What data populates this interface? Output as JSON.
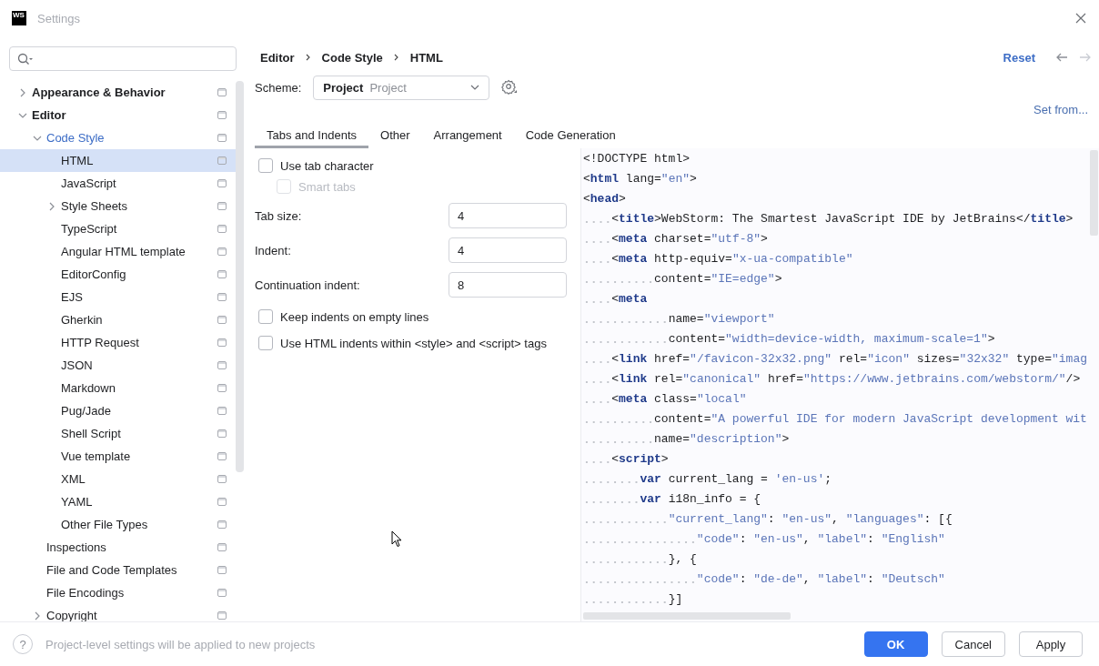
{
  "window": {
    "logo": "WS",
    "title": "Settings"
  },
  "sidebar": {
    "tree": [
      {
        "label": "Appearance & Behavior",
        "kind": "group",
        "expanded": false,
        "selected": false,
        "modified": false
      },
      {
        "label": "Editor",
        "kind": "group",
        "expanded": true,
        "selected": false,
        "modified": false,
        "children": [
          {
            "label": "Code Style",
            "kind": "group",
            "expanded": true,
            "selected": false,
            "modified": true,
            "children": [
              {
                "label": "HTML",
                "kind": "page",
                "selected": true,
                "modified": false
              },
              {
                "label": "JavaScript",
                "kind": "page",
                "selected": false,
                "modified": false
              },
              {
                "label": "Style Sheets",
                "kind": "group",
                "expanded": false,
                "selected": false,
                "modified": false
              },
              {
                "label": "TypeScript",
                "kind": "page",
                "selected": false,
                "modified": false
              },
              {
                "label": "Angular HTML template",
                "kind": "page",
                "selected": false,
                "modified": false
              },
              {
                "label": "EditorConfig",
                "kind": "page",
                "selected": false,
                "modified": false
              },
              {
                "label": "EJS",
                "kind": "page",
                "selected": false,
                "modified": false
              },
              {
                "label": "Gherkin",
                "kind": "page",
                "selected": false,
                "modified": false
              },
              {
                "label": "HTTP Request",
                "kind": "page",
                "selected": false,
                "modified": false
              },
              {
                "label": "JSON",
                "kind": "page",
                "selected": false,
                "modified": false
              },
              {
                "label": "Markdown",
                "kind": "page",
                "selected": false,
                "modified": false
              },
              {
                "label": "Pug/Jade",
                "kind": "page",
                "selected": false,
                "modified": false
              },
              {
                "label": "Shell Script",
                "kind": "page",
                "selected": false,
                "modified": false
              },
              {
                "label": "Vue template",
                "kind": "page",
                "selected": false,
                "modified": false
              },
              {
                "label": "XML",
                "kind": "page",
                "selected": false,
                "modified": false
              },
              {
                "label": "YAML",
                "kind": "page",
                "selected": false,
                "modified": false
              },
              {
                "label": "Other File Types",
                "kind": "page",
                "selected": false,
                "modified": false
              }
            ]
          },
          {
            "label": "Inspections",
            "kind": "page",
            "selected": false,
            "modified": false
          },
          {
            "label": "File and Code Templates",
            "kind": "page",
            "selected": false,
            "modified": false
          },
          {
            "label": "File Encodings",
            "kind": "page",
            "selected": false,
            "modified": false
          },
          {
            "label": "Copyright",
            "kind": "group",
            "expanded": false,
            "selected": false,
            "modified": false
          }
        ]
      }
    ]
  },
  "header": {
    "breadcrumb": [
      "Editor",
      "Code Style",
      "HTML"
    ],
    "reset": "Reset"
  },
  "scheme": {
    "label": "Scheme:",
    "value": "Project",
    "hint": "Project",
    "set_from": "Set from..."
  },
  "tabs": [
    {
      "label": "Tabs and Indents",
      "selected": true
    },
    {
      "label": "Other",
      "selected": false
    },
    {
      "label": "Arrangement",
      "selected": false
    },
    {
      "label": "Code Generation",
      "selected": false
    }
  ],
  "options": [
    {
      "kind": "checkbox",
      "label": "Use tab character",
      "checked": false,
      "disabled": false,
      "children": [
        {
          "kind": "checkbox",
          "label": "Smart tabs",
          "checked": false,
          "disabled": true
        }
      ]
    },
    {
      "kind": "number",
      "label": "Tab size:",
      "value": "4"
    },
    {
      "kind": "number",
      "label": "Indent:",
      "value": "4"
    },
    {
      "kind": "number",
      "label": "Continuation indent:",
      "value": "8"
    },
    {
      "kind": "checkbox",
      "label": "Keep indents on empty lines",
      "checked": false,
      "disabled": false
    },
    {
      "kind": "checkbox",
      "label": "Use HTML indents within <style> and <script> tags",
      "checked": false,
      "disabled": false
    }
  ],
  "preview": [
    [
      {
        "kind": "text",
        "text": "<!DOCTYPE html>"
      }
    ],
    [
      {
        "kind": "p",
        "text": "<"
      },
      {
        "kind": "tag",
        "text": "html"
      },
      {
        "kind": "attr",
        "text": " lang"
      },
      {
        "kind": "p",
        "text": "="
      },
      {
        "kind": "str",
        "text": "\"en\""
      },
      {
        "kind": "p",
        "text": ">"
      }
    ],
    [
      {
        "kind": "p",
        "text": "<"
      },
      {
        "kind": "tag",
        "text": "head"
      },
      {
        "kind": "p",
        "text": ">"
      }
    ],
    [
      {
        "kind": "p",
        "text": "    <"
      },
      {
        "kind": "tag",
        "text": "title"
      },
      {
        "kind": "p",
        "text": ">"
      },
      {
        "kind": "text",
        "text": "WebStorm: The Smartest JavaScript IDE by JetBrains"
      },
      {
        "kind": "p",
        "text": "</"
      },
      {
        "kind": "tag",
        "text": "title"
      },
      {
        "kind": "p",
        "text": ">"
      }
    ],
    [
      {
        "kind": "p",
        "text": "    <"
      },
      {
        "kind": "tag",
        "text": "meta"
      },
      {
        "kind": "attr",
        "text": " charset"
      },
      {
        "kind": "p",
        "text": "="
      },
      {
        "kind": "str",
        "text": "\"utf-8\""
      },
      {
        "kind": "p",
        "text": ">"
      }
    ],
    [
      {
        "kind": "p",
        "text": "    <"
      },
      {
        "kind": "tag",
        "text": "meta"
      },
      {
        "kind": "attr",
        "text": " http-equiv"
      },
      {
        "kind": "p",
        "text": "="
      },
      {
        "kind": "str",
        "text": "\"x-ua-compatible\""
      }
    ],
    [
      {
        "kind": "attr",
        "text": "          content"
      },
      {
        "kind": "p",
        "text": "="
      },
      {
        "kind": "str",
        "text": "\"IE=edge\""
      },
      {
        "kind": "p",
        "text": ">"
      }
    ],
    [
      {
        "kind": "p",
        "text": "    <"
      },
      {
        "kind": "tag",
        "text": "meta"
      }
    ],
    [
      {
        "kind": "attr",
        "text": "            name"
      },
      {
        "kind": "p",
        "text": "="
      },
      {
        "kind": "str",
        "text": "\"viewport\""
      }
    ],
    [
      {
        "kind": "attr",
        "text": "            content"
      },
      {
        "kind": "p",
        "text": "="
      },
      {
        "kind": "str",
        "text": "\"width=device-width, maximum-scale=1\""
      },
      {
        "kind": "p",
        "text": ">"
      }
    ],
    [
      {
        "kind": "p",
        "text": "    <"
      },
      {
        "kind": "tag",
        "text": "link"
      },
      {
        "kind": "attr",
        "text": " href"
      },
      {
        "kind": "p",
        "text": "="
      },
      {
        "kind": "str",
        "text": "\"/favicon-32x32.png\""
      },
      {
        "kind": "attr",
        "text": " rel"
      },
      {
        "kind": "p",
        "text": "="
      },
      {
        "kind": "str",
        "text": "\"icon\""
      },
      {
        "kind": "attr",
        "text": " sizes"
      },
      {
        "kind": "p",
        "text": "="
      },
      {
        "kind": "str",
        "text": "\"32x32\""
      },
      {
        "kind": "attr",
        "text": " type"
      },
      {
        "kind": "p",
        "text": "="
      },
      {
        "kind": "str",
        "text": "\"imag"
      }
    ],
    [
      {
        "kind": "p",
        "text": "    <"
      },
      {
        "kind": "tag",
        "text": "link"
      },
      {
        "kind": "attr",
        "text": " rel"
      },
      {
        "kind": "p",
        "text": "="
      },
      {
        "kind": "str",
        "text": "\"canonical\""
      },
      {
        "kind": "attr",
        "text": " href"
      },
      {
        "kind": "p",
        "text": "="
      },
      {
        "kind": "str",
        "text": "\"https://www.jetbrains.com/webstorm/\""
      },
      {
        "kind": "p",
        "text": "/>"
      }
    ],
    [
      {
        "kind": "p",
        "text": "    <"
      },
      {
        "kind": "tag",
        "text": "meta"
      },
      {
        "kind": "attr",
        "text": " class"
      },
      {
        "kind": "p",
        "text": "="
      },
      {
        "kind": "str",
        "text": "\"local\""
      }
    ],
    [
      {
        "kind": "attr",
        "text": "          content"
      },
      {
        "kind": "p",
        "text": "="
      },
      {
        "kind": "str",
        "text": "\"A powerful IDE for modern JavaScript development wit"
      }
    ],
    [
      {
        "kind": "attr",
        "text": "          name"
      },
      {
        "kind": "p",
        "text": "="
      },
      {
        "kind": "str",
        "text": "\"description\""
      },
      {
        "kind": "p",
        "text": ">"
      }
    ],
    [
      {
        "kind": "p",
        "text": "    <"
      },
      {
        "kind": "tag",
        "text": "script"
      },
      {
        "kind": "p",
        "text": ">"
      }
    ],
    [
      {
        "kind": "kw",
        "text": "        var"
      },
      {
        "kind": "text",
        "text": " current_lang = "
      },
      {
        "kind": "str",
        "text": "'en-us'"
      },
      {
        "kind": "text",
        "text": ";"
      }
    ],
    [
      {
        "kind": "kw",
        "text": "        var"
      },
      {
        "kind": "text",
        "text": " i18n_info = {"
      }
    ],
    [
      {
        "kind": "str",
        "text": "            \"current_lang\""
      },
      {
        "kind": "text",
        "text": ": "
      },
      {
        "kind": "str",
        "text": "\"en-us\""
      },
      {
        "kind": "text",
        "text": ", "
      },
      {
        "kind": "str",
        "text": "\"languages\""
      },
      {
        "kind": "text",
        "text": ": [{"
      }
    ],
    [
      {
        "kind": "str",
        "text": "                \"code\""
      },
      {
        "kind": "text",
        "text": ": "
      },
      {
        "kind": "str",
        "text": "\"en-us\""
      },
      {
        "kind": "text",
        "text": ", "
      },
      {
        "kind": "str",
        "text": "\"label\""
      },
      {
        "kind": "text",
        "text": ": "
      },
      {
        "kind": "str",
        "text": "\"English\""
      }
    ],
    [
      {
        "kind": "text",
        "text": "            }, {"
      }
    ],
    [
      {
        "kind": "str",
        "text": "                \"code\""
      },
      {
        "kind": "text",
        "text": ": "
      },
      {
        "kind": "str",
        "text": "\"de-de\""
      },
      {
        "kind": "text",
        "text": ", "
      },
      {
        "kind": "str",
        "text": "\"label\""
      },
      {
        "kind": "text",
        "text": ": "
      },
      {
        "kind": "str",
        "text": "\"Deutsch\""
      }
    ],
    [
      {
        "kind": "text",
        "text": "            }]"
      }
    ]
  ],
  "footer": {
    "help": "?",
    "note": "Project-level settings will be applied to new projects",
    "buttons": [
      {
        "label": "OK",
        "kind": "primary"
      },
      {
        "label": "Cancel",
        "kind": "normal"
      },
      {
        "label": "Apply",
        "kind": "normal"
      }
    ]
  }
}
